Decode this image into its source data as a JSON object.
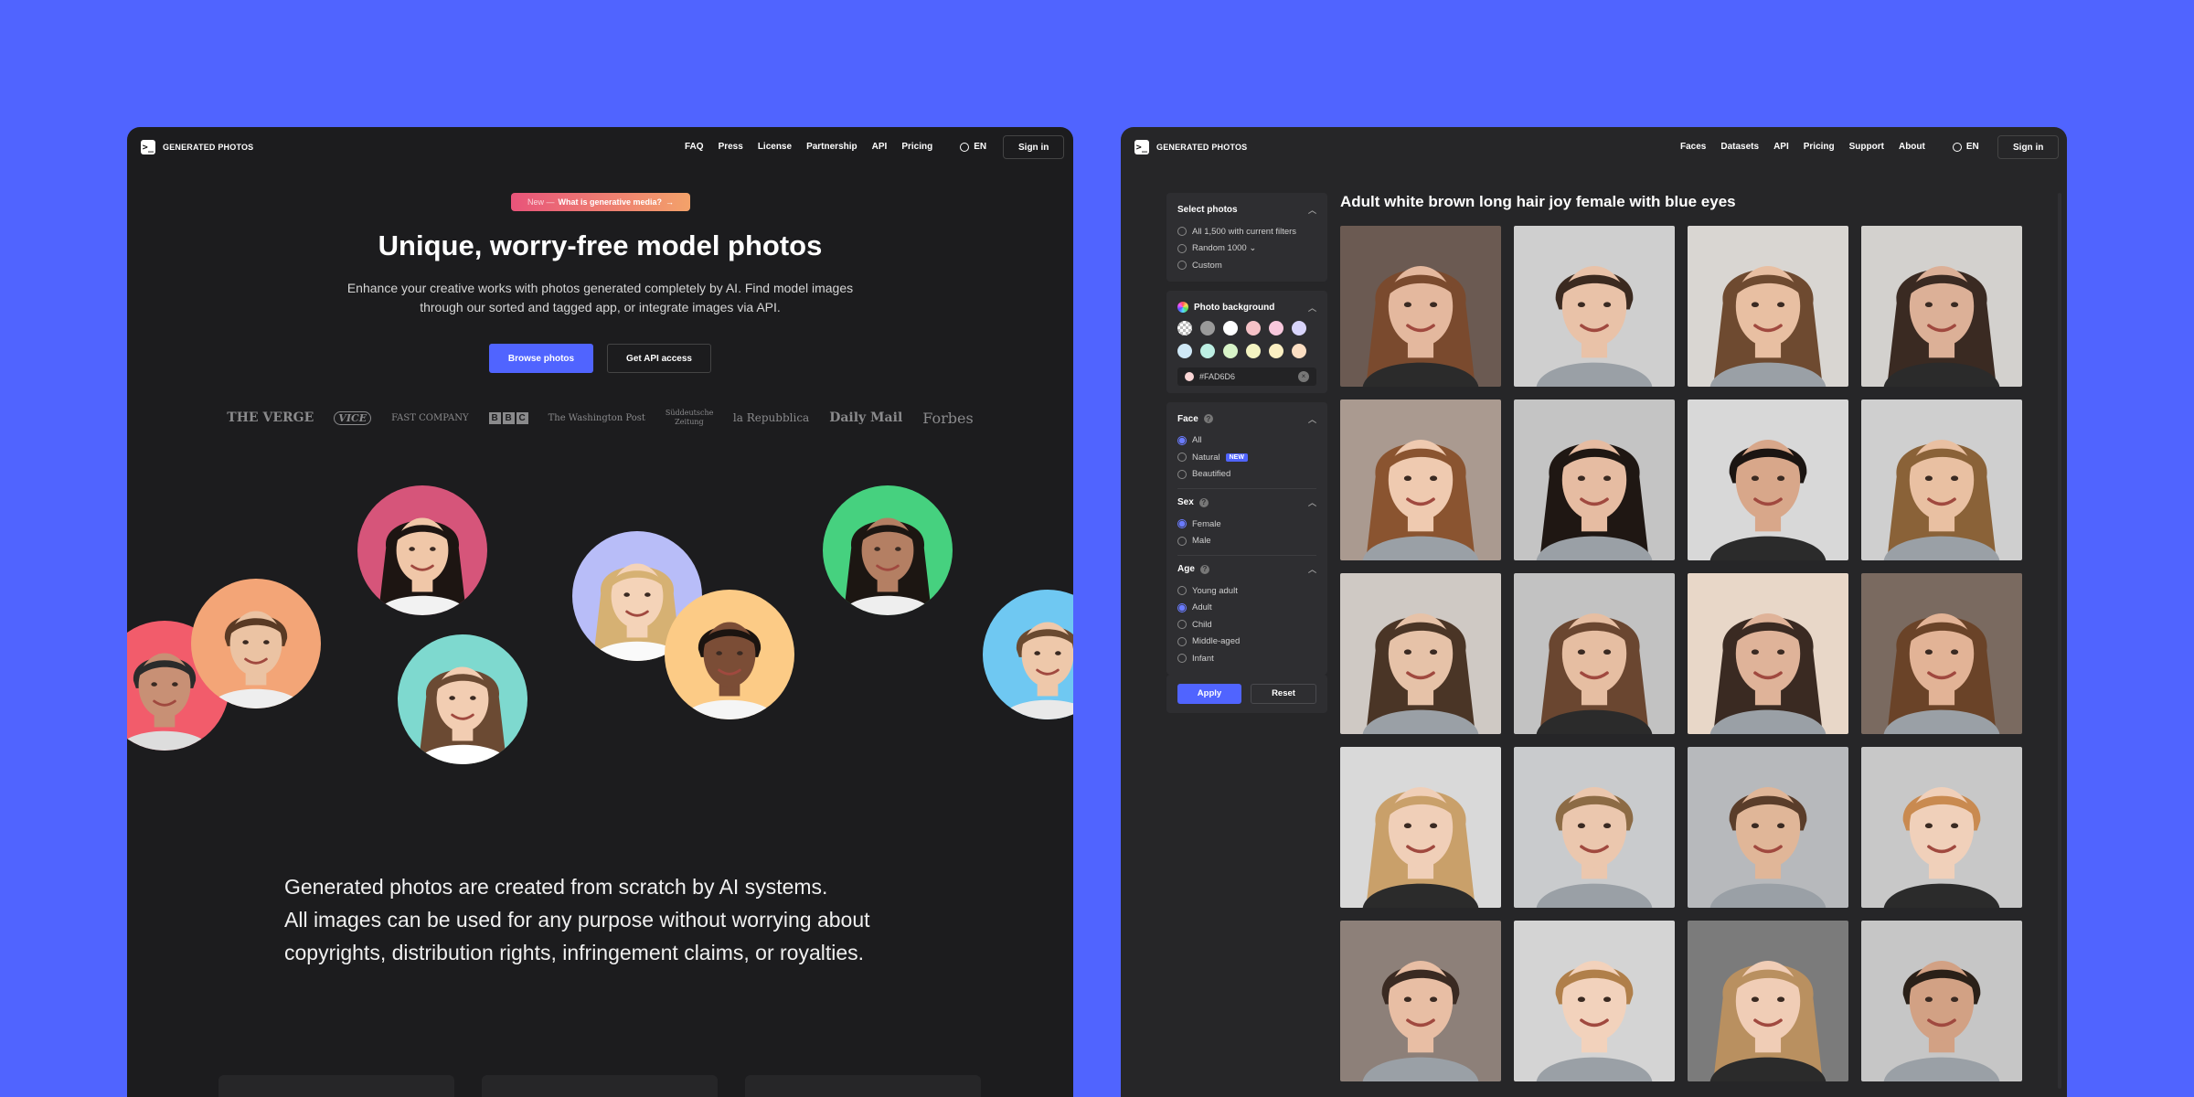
{
  "left": {
    "logo_mark": ">_",
    "logo_text": "GENERATED PHOTOS",
    "nav": [
      "FAQ",
      "Press",
      "License",
      "Partnership",
      "API",
      "Pricing"
    ],
    "lang": "EN",
    "signin": "Sign in",
    "pill_prefix": "New —",
    "pill_text": "What is generative media?",
    "pill_arrow": "→",
    "title": "Unique, worry-free model photos",
    "subtitle": "Enhance your creative works with photos generated completely by AI. Find model images through our sorted and tagged app, or integrate images via API.",
    "btn_browse": "Browse photos",
    "btn_api": "Get API access",
    "press": {
      "verge": "THE VERGE",
      "vice": "VICE",
      "fastco": "FAST COMPANY",
      "bbc": [
        "B",
        "B",
        "C"
      ],
      "wapo": "The Washington Post",
      "sz": "Süddeutsche Zeitung",
      "repubblica": "la Repubblica",
      "dailymail": "Daily Mail",
      "forbes": "Forbes"
    },
    "bottom_lines": [
      "Generated photos are created from scratch by AI systems.",
      "All images can be used for any purpose without worrying about",
      "copyrights, distribution rights, infringement claims, or royalties."
    ]
  },
  "right": {
    "logo_mark": ">_",
    "logo_text": "GENERATED PHOTOS",
    "nav": [
      "Faces",
      "Datasets",
      "API",
      "Pricing",
      "Support",
      "About"
    ],
    "lang": "EN",
    "signin": "Sign in",
    "select_photos": {
      "title": "Select photos",
      "options": [
        "All 1,500 with current filters",
        "Random 1000 ⌄",
        "Custom"
      ]
    },
    "background": {
      "title": "Photo background",
      "hex": "#FAD6D6",
      "swatches": [
        "#BBBBBB",
        "#9A9A9A",
        "#FFFFFF",
        "#F6C2C7",
        "#F8C8DC",
        "#D8D4FA",
        "#CFE8F6",
        "#BDEFE3",
        "#D8F4C8",
        "#F4F4C2",
        "#FBEFC2",
        "#FBDEC2"
      ]
    },
    "face": {
      "title": "Face",
      "options": [
        "All",
        "Natural",
        "Beautified"
      ],
      "badge": "NEW",
      "selected": 0
    },
    "sex": {
      "title": "Sex",
      "options": [
        "Female",
        "Male"
      ],
      "selected": 0
    },
    "age": {
      "title": "Age",
      "options": [
        "Young adult",
        "Adult",
        "Child",
        "Middle-aged",
        "Infant"
      ],
      "selected": 1
    },
    "apply": "Apply",
    "reset": "Reset",
    "results_title": "Adult white brown long hair joy female with blue eyes"
  },
  "colors": {
    "brand": "#5064FF",
    "panel_dark": "#1C1C1E",
    "panel_right": "#262628"
  }
}
